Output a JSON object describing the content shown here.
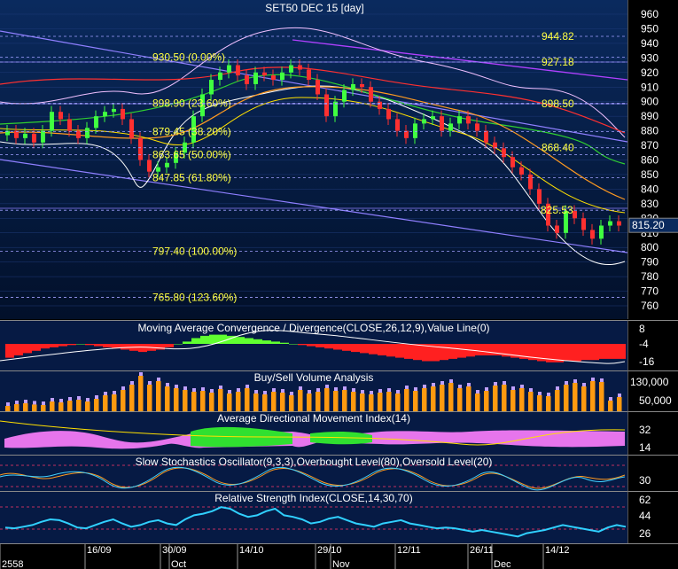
{
  "chart_data": {
    "title": "SET50 DEC 15   [day]",
    "type": "candlestick",
    "price_panel": {
      "y_ticks": [
        960,
        950,
        940,
        930,
        920,
        910,
        900,
        890,
        880,
        870,
        860,
        850,
        840,
        830,
        820,
        810,
        800,
        790,
        780,
        770,
        760
      ],
      "last_price": "815.20",
      "fib_levels": [
        {
          "label": "930.50 (0.00%)",
          "value": 930.5
        },
        {
          "label": "898.90 (23.60%)",
          "value": 898.9
        },
        {
          "label": "879.45 (38.20%)",
          "value": 879.45
        },
        {
          "label": "863.65 (50.00%)",
          "value": 863.65
        },
        {
          "label": "847.85 (61.80%)",
          "value": 847.85
        },
        {
          "label": "797.40 (100.00%)",
          "value": 797.4
        },
        {
          "label": "765.80 (123.60%)",
          "value": 765.8
        }
      ],
      "right_levels": [
        {
          "label": "944.82",
          "value": 944.82
        },
        {
          "label": "927.18",
          "value": 927.18
        },
        {
          "label": "898.50",
          "value": 898.5
        },
        {
          "label": "868.40",
          "value": 868.4
        },
        {
          "label": "825.53",
          "value": 825.53
        }
      ],
      "closes": [
        880,
        875,
        878,
        872,
        880,
        893,
        888,
        880,
        875,
        882,
        890,
        893,
        895,
        888,
        875,
        860,
        852,
        855,
        858,
        865,
        872,
        890,
        905,
        915,
        920,
        925,
        918,
        912,
        920,
        918,
        915,
        920,
        925,
        922,
        915,
        905,
        890,
        900,
        908,
        912,
        910,
        900,
        895,
        888,
        880,
        875,
        885,
        888,
        890,
        880,
        885,
        890,
        885,
        880,
        872,
        868,
        862,
        855,
        850,
        840,
        830,
        815,
        810,
        825,
        820,
        812,
        806,
        815,
        818,
        815
      ]
    },
    "macd": {
      "title": "Moving Average Convergence / Divergence(CLOSE,26,12,9),Value Line(0)",
      "y_ticks": [
        "8",
        "-4",
        "-16"
      ],
      "values": [
        -12,
        -10,
        -8,
        -6,
        -4,
        -3,
        -2,
        -1,
        0,
        -1,
        -2,
        -3,
        -4,
        -5,
        -6,
        -7,
        -6,
        -5,
        -3,
        0,
        2,
        5,
        7,
        8,
        8,
        7,
        6,
        5,
        4,
        3,
        2,
        1,
        0,
        -1,
        -2,
        -3,
        -4,
        -5,
        -6,
        -7,
        -8,
        -9,
        -10,
        -11,
        -12,
        -13,
        -14,
        -15,
        -15,
        -14,
        -13,
        -12,
        -11,
        -10,
        -10,
        -10,
        -11,
        -12,
        -13,
        -14,
        -15,
        -16,
        -16,
        -15,
        -15,
        -14,
        -14,
        -13,
        -13,
        -13
      ]
    },
    "volume": {
      "title": "Buy/Sell Volume Analysis",
      "y_ticks": [
        "130,000",
        "50,000"
      ],
      "values": [
        30,
        40,
        45,
        38,
        35,
        55,
        50,
        60,
        65,
        55,
        70,
        90,
        95,
        120,
        150,
        200,
        150,
        170,
        140,
        130,
        120,
        110,
        115,
        105,
        125,
        100,
        110,
        130,
        100,
        95,
        110,
        105,
        90,
        120,
        100,
        110,
        130,
        115,
        120,
        110,
        100,
        95,
        105,
        110,
        100,
        125,
        115,
        130,
        140,
        150,
        160,
        130,
        140,
        100,
        115,
        145,
        150,
        120,
        130,
        110,
        90,
        85,
        120,
        150,
        160,
        140,
        170,
        165,
        60,
        80
      ]
    },
    "adx": {
      "title": "Average Directional Movement Index(14)",
      "y_ticks": [
        "32",
        "14"
      ]
    },
    "stoch": {
      "title": "Slow Stochastics Oscillator(9,3,3),Overbought Level(80),Oversold Level(20)",
      "y_ticks": [
        "30"
      ]
    },
    "rsi": {
      "title": "Relative Strength Index(CLOSE,14,30,70)",
      "y_ticks": [
        "62",
        "44",
        "26"
      ],
      "values": [
        35,
        34,
        36,
        38,
        42,
        45,
        44,
        40,
        35,
        34,
        38,
        42,
        45,
        40,
        36,
        38,
        42,
        44,
        40,
        38,
        45,
        50,
        52,
        55,
        60,
        58,
        52,
        48,
        50,
        55,
        58,
        50,
        48,
        45,
        40,
        42,
        46,
        48,
        44,
        40,
        38,
        36,
        40,
        42,
        44,
        40,
        38,
        36,
        34,
        35,
        34,
        32,
        30,
        32,
        30,
        28,
        26,
        24,
        28,
        30,
        32,
        35,
        38,
        36,
        34,
        32,
        30,
        35,
        38,
        36
      ]
    },
    "x_labels": [
      "2558",
      "16/09",
      "30/09",
      "Oct",
      "14/10",
      "29/10",
      "Nov",
      "12/11",
      "26/11",
      "Dec",
      "14/12"
    ]
  }
}
